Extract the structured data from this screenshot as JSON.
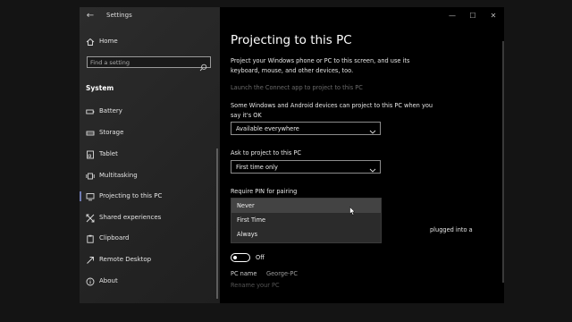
{
  "window": {
    "app_title": "Settings",
    "controls": {
      "minimize": "—",
      "maximize": "☐",
      "close": "✕"
    }
  },
  "sidebar": {
    "home_label": "Home",
    "search_placeholder": "Find a setting",
    "section_heading": "System",
    "items": [
      {
        "label": "Battery",
        "icon": "battery-icon"
      },
      {
        "label": "Storage",
        "icon": "storage-icon"
      },
      {
        "label": "Tablet",
        "icon": "tablet-icon"
      },
      {
        "label": "Multitasking",
        "icon": "multitasking-icon"
      },
      {
        "label": "Projecting to this PC",
        "icon": "projecting-icon",
        "active": true
      },
      {
        "label": "Shared experiences",
        "icon": "shared-experiences-icon"
      },
      {
        "label": "Clipboard",
        "icon": "clipboard-icon"
      },
      {
        "label": "Remote Desktop",
        "icon": "remote-desktop-icon"
      },
      {
        "label": "About",
        "icon": "info-icon"
      }
    ]
  },
  "main": {
    "title": "Projecting to this PC",
    "description": "Project your Windows phone or PC to this screen, and use its keyboard, mouse, and other devices, too.",
    "launch_link": "Launch the Connect app to project to this PC",
    "availability_label": "Some Windows and Android devices can project to this PC when you say it's OK",
    "availability_value": "Available everywhere",
    "ask_label": "Ask to project to this PC",
    "ask_value": "First time only",
    "pin_label": "Require PIN for pairing",
    "pin_options": [
      "Never",
      "First Time",
      "Always"
    ],
    "pin_hovered": "Never",
    "notify_fragment": "plugged into a",
    "toggle_state": "Off",
    "toggle_on": false,
    "pc_name_label": "PC name",
    "pc_name_value": "George-PC",
    "rename_link": "Rename your PC"
  },
  "colors": {
    "accent": "#6f7bb3",
    "window_bg": "#000000",
    "sidebar_bg": "#2a2a2a",
    "menu_bg": "#2b2b2b",
    "menu_hover": "#434343",
    "disabled_text": "#6a6a6a"
  }
}
